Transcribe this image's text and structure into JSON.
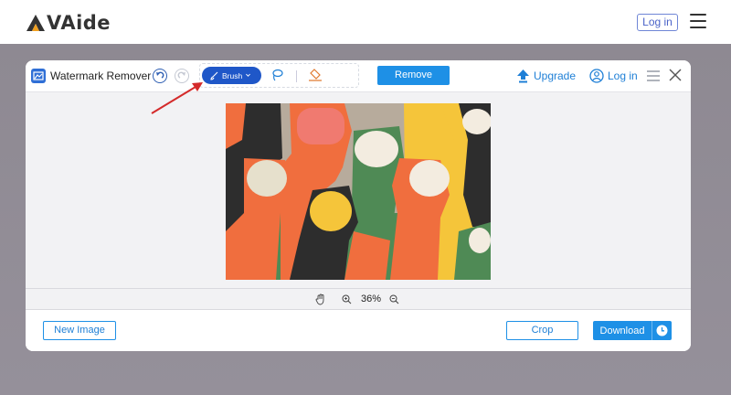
{
  "site": {
    "brand": "VAide",
    "login_label": "Log in"
  },
  "modal": {
    "title": "Watermark Remover",
    "brush_label": "Brush",
    "remove_label": "Remove",
    "upgrade_label": "Upgrade",
    "login_label": "Log in",
    "zoom_value": "36%",
    "new_image_label": "New Image",
    "crop_label": "Crop",
    "download_label": "Download"
  },
  "colors": {
    "accent": "#1e90e6",
    "brush_active": "#1f57c8",
    "annotation_arrow": "#d42a2a"
  },
  "icons": {
    "logo": "aviade-logo-icon",
    "app": "watermark-remover-app-icon",
    "undo": "undo-icon",
    "redo": "redo-icon",
    "brush": "brush-icon",
    "lasso": "lasso-icon",
    "eraser": "eraser-icon",
    "upgrade": "upgrade-arrow-icon",
    "user": "user-icon",
    "menu": "hamburger-menu-icon",
    "close": "close-icon",
    "hand": "hand-pan-icon",
    "zoom_in": "zoom-in-icon",
    "zoom_out": "zoom-out-icon",
    "clock": "clock-icon"
  }
}
